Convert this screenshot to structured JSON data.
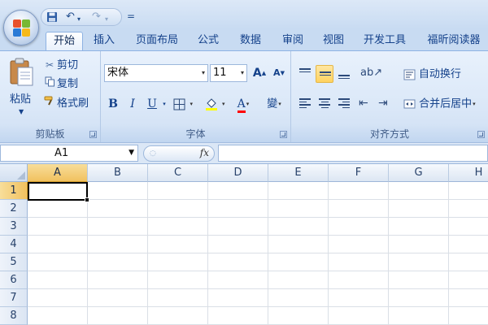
{
  "quick_access": {
    "customize_glyph": "="
  },
  "tabs": [
    {
      "label": "开始",
      "active": true
    },
    {
      "label": "插入",
      "active": false
    },
    {
      "label": "页面布局",
      "active": false
    },
    {
      "label": "公式",
      "active": false
    },
    {
      "label": "数据",
      "active": false
    },
    {
      "label": "审阅",
      "active": false
    },
    {
      "label": "视图",
      "active": false
    },
    {
      "label": "开发工具",
      "active": false
    },
    {
      "label": "福昕阅读器",
      "active": false
    }
  ],
  "clipboard": {
    "paste_label": "粘贴",
    "cut_label": "剪切",
    "copy_label": "复制",
    "format_painter_label": "格式刷",
    "group_label": "剪贴板"
  },
  "font": {
    "font_name": "宋体",
    "font_size": "11",
    "grow_label": "A",
    "shrink_label": "A",
    "bold_label": "B",
    "italic_label": "I",
    "underline_label": "U",
    "font_color_label": "A",
    "phonetic_label": "變",
    "group_label": "字体",
    "fill_color": "#ffff00",
    "font_color": "#ff0000"
  },
  "alignment": {
    "wrap_label": "自动换行",
    "merge_label": "合并后居中",
    "group_label": "对齐方式",
    "highlight_color": "#ffd35f"
  },
  "formula_bar": {
    "name_box": "A1",
    "fx_label": "fx",
    "formula": ""
  },
  "sheet": {
    "columns": [
      "A",
      "B",
      "C",
      "D",
      "E",
      "F",
      "G",
      "H"
    ],
    "rows": [
      "1",
      "2",
      "3",
      "4",
      "5",
      "6",
      "7",
      "8"
    ],
    "active_column": "A",
    "active_row": "1"
  },
  "colors": {
    "ribbon_bg": "#dbe8f8",
    "header_selected": "#f1c15f",
    "tab_text": "#15428b"
  }
}
